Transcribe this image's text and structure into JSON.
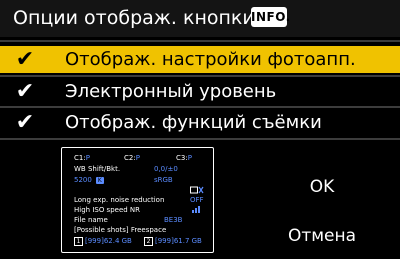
{
  "header": {
    "title": "Опции отображ. кнопки",
    "info_badge": "INFO."
  },
  "options": [
    {
      "check": "✔",
      "label": "Отображ. настройки фотоапп.",
      "selected": true
    },
    {
      "check": "✔",
      "label": "Электронный уровень",
      "selected": false
    },
    {
      "check": "✔",
      "label": "Отображ. функций съёмки",
      "selected": false
    }
  ],
  "preview": {
    "c1_label": "C1:",
    "c1_value": "P",
    "c2_label": "C2:",
    "c2_value": "P",
    "c3_label": "C3:",
    "c3_value": "P",
    "wb_label": "WB Shift/Bkt.",
    "wb_value": "0,0/±0",
    "kelvin": "5200",
    "kelvin_badge": "K",
    "color_space": "sRGB",
    "long_exp_label": "Long exp. noise reduction",
    "long_exp_value": "OFF",
    "high_iso_label": "High ISO speed NR",
    "file_name_label": "File name",
    "file_name_value": "BE3B",
    "freespace_label": "[Possible shots] Freespace",
    "card1_id": "1",
    "card1_value": "[999]62.4 GB",
    "card2_id": "2",
    "card2_value": "[999]61.7 GB"
  },
  "buttons": {
    "ok": "OK",
    "cancel": "Отмена"
  },
  "colors": {
    "selected_row": "#f0c200",
    "header_bg": "#141414",
    "accent_blue": "#5b8cff"
  }
}
